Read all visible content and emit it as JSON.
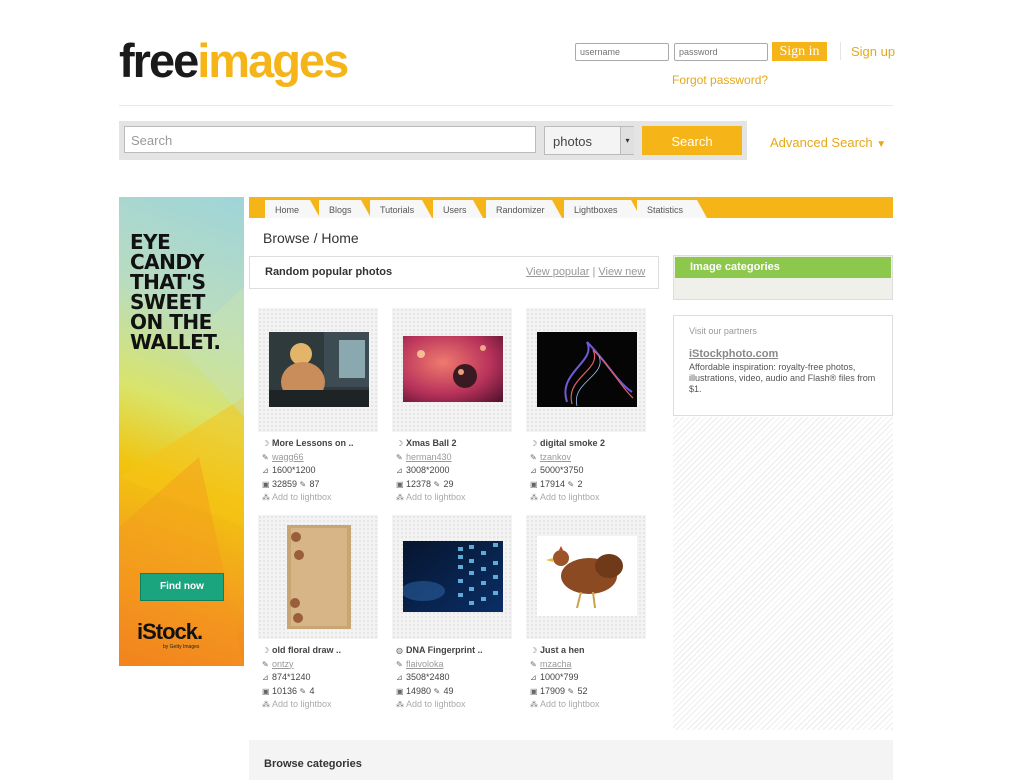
{
  "header": {
    "logo_part1": "free",
    "logo_part2": "images",
    "username_placeholder": "username",
    "password_placeholder": "password",
    "signin_label": "Sign in",
    "signup_label": "Sign up",
    "forgot_label": "Forgot password?"
  },
  "search": {
    "placeholder": "Search",
    "type_selected": "photos",
    "button_label": "Search",
    "advanced_label": "Advanced Search"
  },
  "ad": {
    "line1": "EYE",
    "line2": "CANDY",
    "line3": "THAT'S",
    "line4": "SWEET",
    "line5": "ON THE",
    "line6": "WALLET.",
    "button": "Find now",
    "brand": "iStock.",
    "brand_sub": "by Getty Images"
  },
  "nav": {
    "tabs": [
      "Home",
      "Blogs",
      "Tutorials",
      "Users",
      "Randomizer",
      "Lightboxes",
      "Statistics"
    ]
  },
  "breadcrumb": "Browse / Home",
  "random_popular": {
    "title": "Random popular photos",
    "view_popular": "View popular",
    "separator": "|",
    "view_new": "View new"
  },
  "photos": [
    {
      "title": "More Lessons on ..",
      "user": "wagg66",
      "resolution": "1600*1200",
      "views": "32859",
      "comments": "87",
      "lightbox": "Add to lightbox"
    },
    {
      "title": "Xmas Ball 2",
      "user": "herman430",
      "resolution": "3008*2000",
      "views": "12378",
      "comments": "29",
      "lightbox": "Add to lightbox"
    },
    {
      "title": "digital smoke 2",
      "user": "tzankov",
      "resolution": "5000*3750",
      "views": "17914",
      "comments": "2",
      "lightbox": "Add to lightbox"
    },
    {
      "title": "old floral draw ..",
      "user": "ontzy",
      "resolution": "874*1240",
      "views": "10136",
      "comments": "4",
      "lightbox": "Add to lightbox"
    },
    {
      "title": "DNA Fingerprint ..",
      "user": "flaivoloka",
      "resolution": "3508*2480",
      "views": "14980",
      "comments": "49",
      "lightbox": "Add to lightbox"
    },
    {
      "title": "Just a hen",
      "user": "mzacha",
      "resolution": "1000*799",
      "views": "17909",
      "comments": "52",
      "lightbox": "Add to lightbox"
    }
  ],
  "sidebar": {
    "categories_title": "Image categories",
    "partners_label": "Visit our partners",
    "partner_link": "iStockphoto.com",
    "partner_desc": "Affordable inspiration: royalty-free photos, illustrations, video, audio and Flash® files from $1."
  },
  "browse_categories_title": "Browse categories",
  "colors": {
    "accent": "#f5b417",
    "category_green": "#8cc84b",
    "ad_button": "#1aa57e"
  }
}
